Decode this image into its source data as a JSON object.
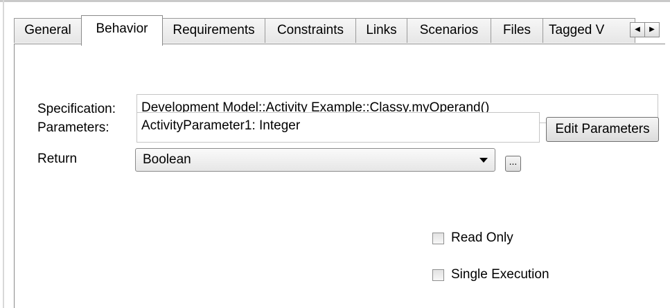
{
  "tabs": [
    {
      "label": "General",
      "active": false
    },
    {
      "label": "Behavior",
      "active": true
    },
    {
      "label": "Requirements",
      "active": false
    },
    {
      "label": "Constraints",
      "active": false
    },
    {
      "label": "Links",
      "active": false
    },
    {
      "label": "Scenarios",
      "active": false
    },
    {
      "label": "Files",
      "active": false
    },
    {
      "label": "Tagged V",
      "active": false
    }
  ],
  "tab_scroll": {
    "left": "◀",
    "right": "▶"
  },
  "form": {
    "specification_label": "Specification:",
    "specification_value": "Development Model::Activity Example::Classy.myOperand()",
    "parameters_label": "Parameters:",
    "parameters_value": "ActivityParameter1: Integer",
    "edit_parameters_label": "Edit Parameters",
    "return_label": "Return",
    "return_value": "Boolean",
    "browse_label": "...",
    "read_only_label": "Read Only",
    "read_only_checked": false,
    "single_execution_label": "Single Execution",
    "single_execution_checked": false
  }
}
